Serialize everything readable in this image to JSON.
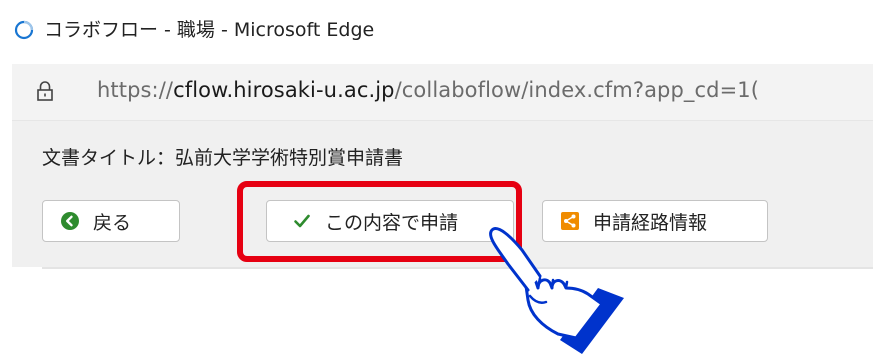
{
  "window": {
    "title": "コラボフロー - 職場 - Microsoft Edge",
    "browser_icon": "edge-loading-icon"
  },
  "address": {
    "lock_icon": "lock-icon",
    "scheme": "https://",
    "host": "cflow.hirosaki-u.ac.jp",
    "path": "/collaboflow/index.cfm?app_cd=1("
  },
  "page": {
    "doc_title": "文書タイトル：弘前大学学術特別賞申請書"
  },
  "toolbar": {
    "back_label": "戻る",
    "back_icon": "arrow-left-circle-icon",
    "apply_label": "この内容で申請",
    "apply_icon": "checkmark-icon",
    "route_label": "申請経路情報",
    "route_icon": "share-icon"
  },
  "annotation": {
    "highlight_color": "#e60012",
    "pointer": "pointing-hand-icon",
    "pointer_color": "#0033cc"
  }
}
